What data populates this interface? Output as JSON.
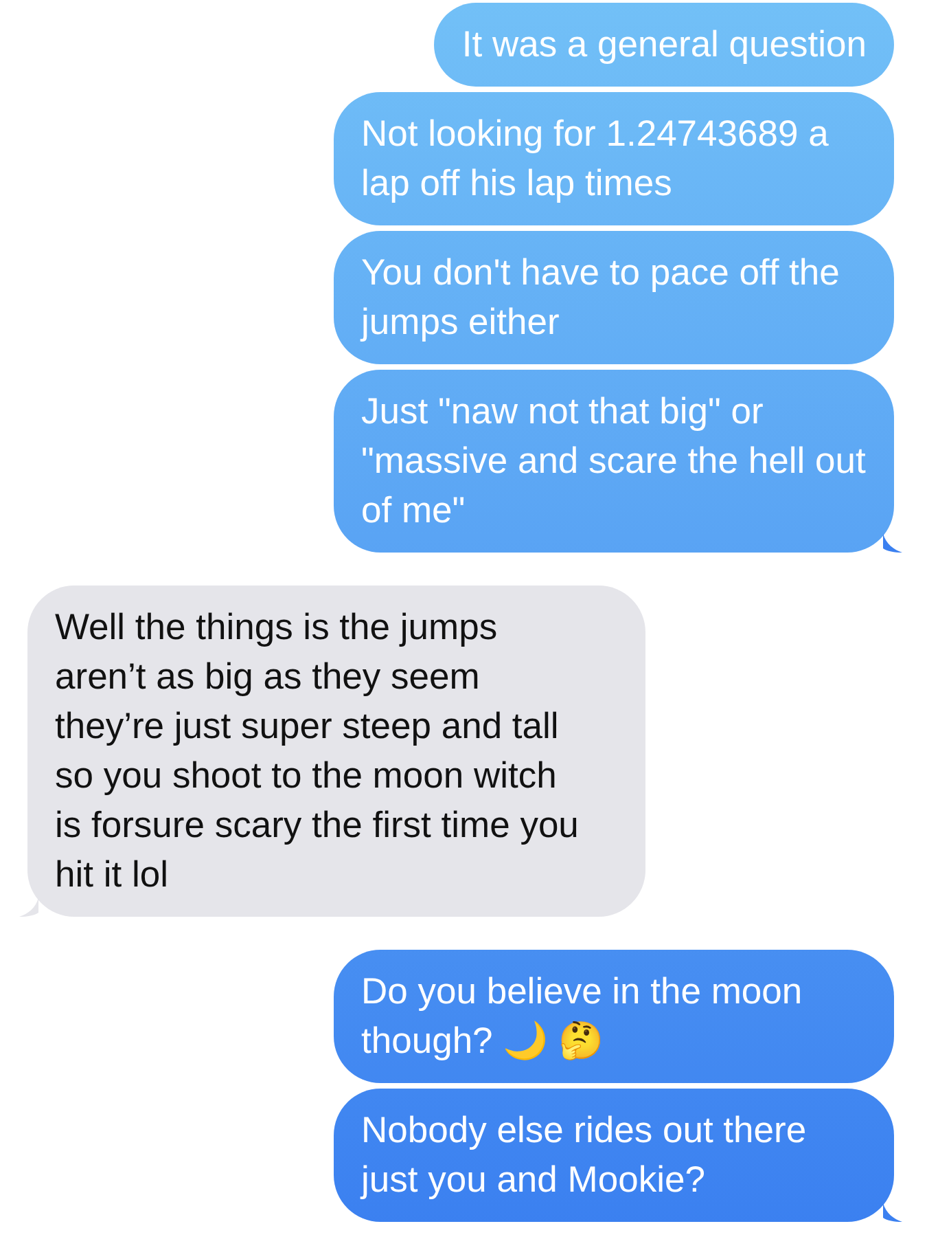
{
  "messages": [
    {
      "kind": "sent",
      "tail": false,
      "text": "It was a general question"
    },
    {
      "kind": "sent",
      "tail": false,
      "text": "Not looking for 1.24743689 a lap off his lap times"
    },
    {
      "kind": "sent",
      "tail": false,
      "text": "You don't have to pace off the jumps either"
    },
    {
      "kind": "sent",
      "tail": true,
      "text": "Just \"naw not that big\" or \"massive and scare the hell out of me\""
    },
    {
      "kind": "received",
      "tail": true,
      "text": "Well the things is the jumps aren’t as big as they seem they’re just super steep and tall so you shoot to the moon witch is forsure scary the first time you hit it lol"
    },
    {
      "kind": "sent",
      "tail": false,
      "text": "Do you believe in the moon though? 🌙 🤔"
    },
    {
      "kind": "sent",
      "tail": true,
      "text": "Nobody else rides out there just you and Mookie?"
    }
  ]
}
